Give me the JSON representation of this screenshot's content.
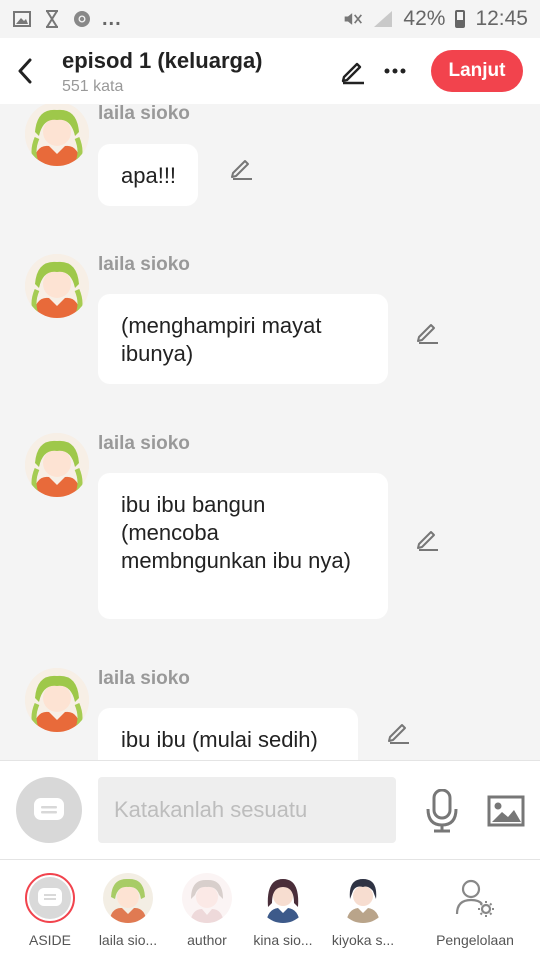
{
  "status_bar": {
    "battery": "42%",
    "time": "12:45",
    "dots": "..."
  },
  "header": {
    "title": "episod 1 (keluarga)",
    "word_count": "551 kata",
    "next_label": "Lanjut",
    "accent": "#f2434d"
  },
  "messages": [
    {
      "sender": "laila sioko",
      "text": "apa!!!"
    },
    {
      "sender": "laila sioko",
      "text": "(menghampiri mayat ibunya)"
    },
    {
      "sender": "laila sioko",
      "text": "ibu ibu bangun (mencoba membngunkan ibu nya)"
    },
    {
      "sender": "laila sioko",
      "text": "ibu ibu (mulai sedih)"
    }
  ],
  "composer": {
    "placeholder": "Katakanlah sesuatu"
  },
  "characters": [
    {
      "label": "ASIDE",
      "icon": "aside-icon"
    },
    {
      "label": "laila sio...",
      "icon": "avatar-laila"
    },
    {
      "label": "author",
      "icon": "avatar-author"
    },
    {
      "label": "kina sio...",
      "icon": "avatar-kina"
    },
    {
      "label": "kiyoka s...",
      "icon": "avatar-kiyoka"
    },
    {
      "label": "Pengelolaan",
      "icon": "user-gear-icon"
    }
  ]
}
